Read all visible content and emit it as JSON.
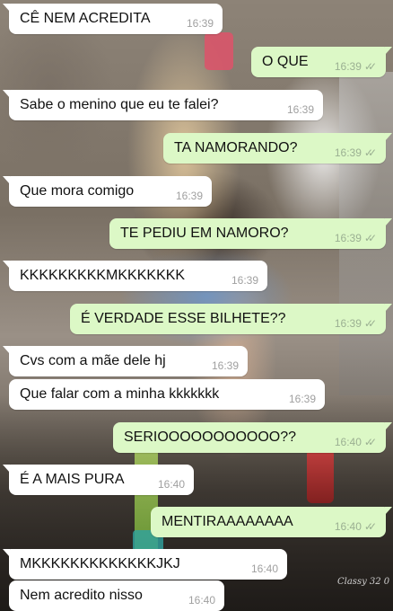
{
  "messages": [
    {
      "dir": "incoming",
      "text": "CÊ NEM ACREDITA",
      "time": "16:39"
    },
    {
      "dir": "outgoing",
      "text": "O QUE",
      "time": "16:39",
      "status": "delivered"
    },
    {
      "dir": "incoming",
      "text": "Sabe o menino que eu te falei?",
      "time": "16:39"
    },
    {
      "dir": "outgoing",
      "text": "TA NAMORANDO?",
      "time": "16:39",
      "status": "delivered"
    },
    {
      "dir": "incoming",
      "text": "Que mora comigo",
      "time": "16:39"
    },
    {
      "dir": "outgoing",
      "text": "TE PEDIU EM NAMORO?",
      "time": "16:39",
      "status": "delivered"
    },
    {
      "dir": "incoming",
      "text": "KKKKKKKKKMKKKKKKK",
      "time": "16:39"
    },
    {
      "dir": "outgoing",
      "text": "É VERDADE ESSE BILHETE??",
      "time": "16:39",
      "status": "delivered"
    },
    {
      "dir": "incoming",
      "text": "Cvs com a mãe dele hj",
      "time": "16:39"
    },
    {
      "dir": "incoming",
      "text": "Que falar com a minha kkkkkkk",
      "time": "16:39"
    },
    {
      "dir": "outgoing",
      "text": "SERIOOOOOOOOOOO??",
      "time": "16:40",
      "status": "delivered"
    },
    {
      "dir": "incoming",
      "text": "É A MAIS PURA",
      "time": "16:40"
    },
    {
      "dir": "outgoing",
      "text": "MENTIRAAAAAAAA",
      "time": "16:40",
      "status": "delivered"
    },
    {
      "dir": "incoming",
      "text": "MKKKKKKKKKKKKKJKJ",
      "time": "16:40"
    },
    {
      "dir": "incoming",
      "text": "Nem acredito nisso",
      "time": "16:40"
    }
  ],
  "background": {
    "watermark_text": "Classy 32 0"
  },
  "colors": {
    "incoming_bubble": "#ffffff",
    "outgoing_bubble": "#dcf8c6",
    "timestamp_gray": "#a0a0a0",
    "tick_gray": "#9bb092"
  }
}
